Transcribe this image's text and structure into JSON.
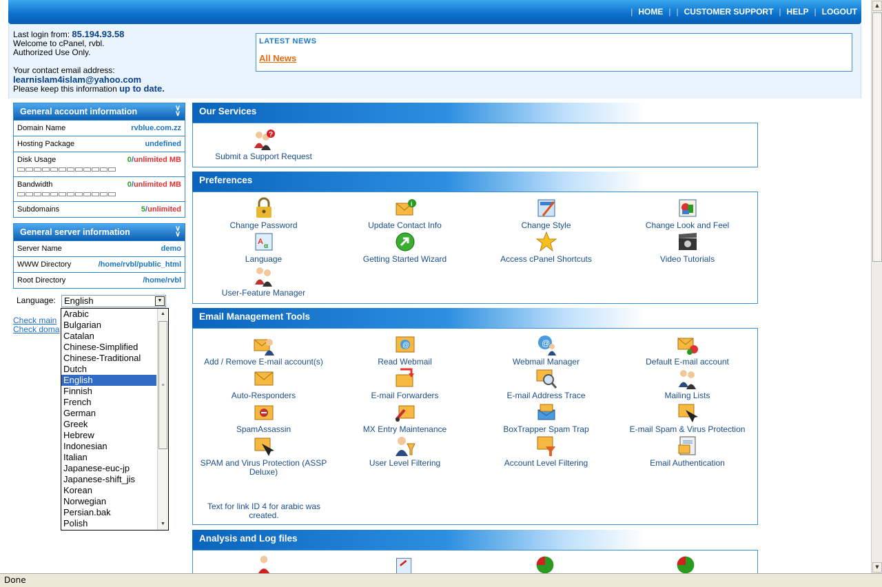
{
  "header": {
    "nav": [
      "HOME",
      "CUSTOMER SUPPORT",
      "HELP",
      "LOGOUT"
    ]
  },
  "login": {
    "last_login_label": "Last login from:",
    "ip": "85.194.93.58",
    "welcome": "Welcome to cPanel, rvbl.",
    "authorized": "Authorized Use Only.",
    "contact_label": "Your contact email address:",
    "email": "learnislam4islam@yahoo.com",
    "keep_prefix": "Please keep this information",
    "keep_link": "up to date",
    "keep_suffix": "."
  },
  "news": {
    "title": "LATEST NEWS",
    "all_news": "All News"
  },
  "account": {
    "title": "General account information",
    "domain_label": "Domain Name",
    "domain_value": "rvblue.com.zz",
    "hosting_label": "Hosting Package",
    "hosting_value": "undefined",
    "disk_label": "Disk Usage",
    "disk_used": "0",
    "disk_sep": "/",
    "disk_limit": "unlimited MB",
    "bandwidth_label": "Bandwidth",
    "bw_used": "0",
    "bw_sep": "/",
    "bw_limit": "unlimited MB",
    "subdomains_label": "Subdomains",
    "sub_used": "5",
    "sub_sep": "/",
    "sub_limit": "unlimited"
  },
  "server": {
    "title": "General server information",
    "server_label": "Server Name",
    "server_value": "demo",
    "www_label": "WWW Directory",
    "www_value": "/home/rvbl/public_html",
    "root_label": "Root Directory",
    "root_value": "/home/rvbl"
  },
  "language": {
    "label": "Language:",
    "selected": "English",
    "options": [
      "Arabic",
      "Bulgarian",
      "Catalan",
      "Chinese-Simplified",
      "Chinese-Traditional",
      "Dutch",
      "English",
      "Finnish",
      "French",
      "German",
      "Greek",
      "Hebrew",
      "Indonesian",
      "Italian",
      "Japanese-euc-jp",
      "Japanese-shift_jis",
      "Korean",
      "Norwegian",
      "Persian.bak",
      "Polish"
    ]
  },
  "checklinks": [
    "Check main",
    "Check doma"
  ],
  "sections": {
    "services": {
      "title": "Our Services",
      "items": [
        "Submit a Support Request"
      ]
    },
    "preferences": {
      "title": "Preferences",
      "items": [
        "Change Password",
        "Update Contact Info",
        "Change Style",
        "Change Look and Feel",
        "Language",
        "Getting Started Wizard",
        "Access cPanel Shortcuts",
        "Video Tutorials",
        "User-Feature Manager"
      ]
    },
    "email": {
      "title": "Email Management Tools",
      "items": [
        "Add / Remove E-mail account(s)",
        "Read Webmail",
        "Webmail Manager",
        "Default E-mail account",
        "Auto-Responders",
        "E-mail Forwarders",
        "E-mail Address Trace",
        "Mailing Lists",
        "SpamAssassin",
        "MX Entry Maintenance",
        "BoxTrapper Spam Trap",
        "E-mail Spam & Virus Protection",
        "SPAM and Virus Protection (ASSP Deluxe)",
        "User Level Filtering",
        "Account Level Filtering",
        "Email Authentication"
      ],
      "note": "Text for link ID 4 for arabic was created."
    },
    "analysis": {
      "title": "Analysis and Log files"
    }
  },
  "status": "Done",
  "colors": {
    "accent": "#0a6fc9",
    "link": "#1a74c4",
    "news_link": "#e86a0c",
    "green": "#2a9a20",
    "red": "#e23030"
  }
}
